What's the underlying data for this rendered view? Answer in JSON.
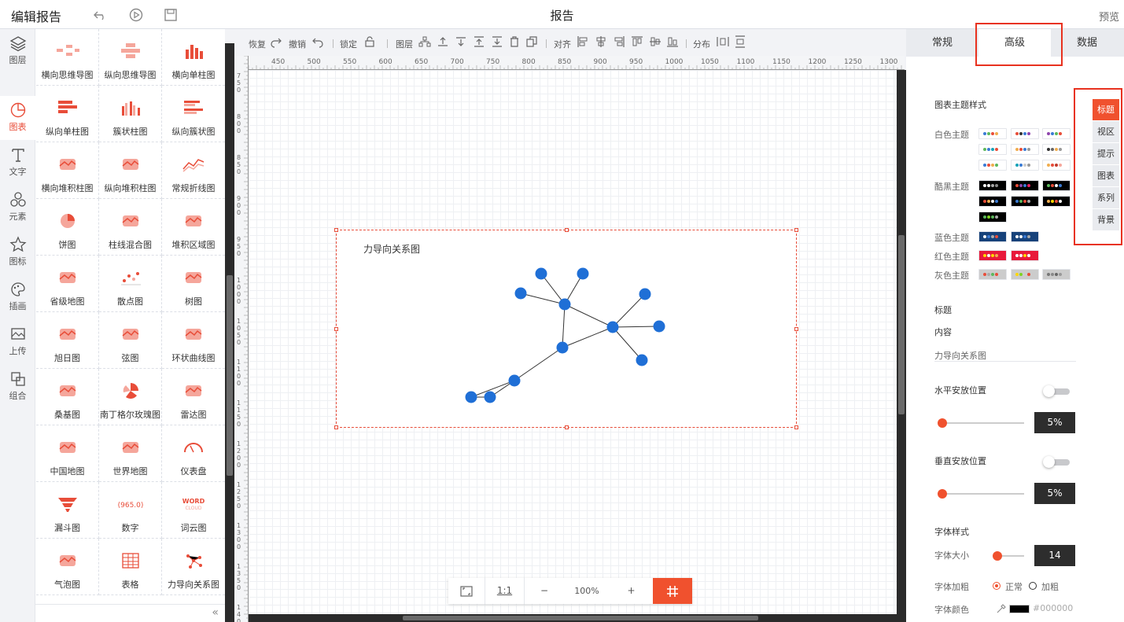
{
  "header": {
    "title": "编辑报告",
    "center": "报告",
    "preview": "预览"
  },
  "left_nav": [
    {
      "label": "图层",
      "icon": "layers-icon"
    },
    {
      "label": "图表",
      "icon": "chart-icon",
      "active": true
    },
    {
      "label": "文字",
      "icon": "text-icon"
    },
    {
      "label": "元素",
      "icon": "elements-icon"
    },
    {
      "label": "图标",
      "icon": "star-icon"
    },
    {
      "label": "插画",
      "icon": "palette-icon"
    },
    {
      "label": "上传",
      "icon": "upload-image-icon"
    },
    {
      "label": "组合",
      "icon": "group-icon"
    }
  ],
  "palette": [
    {
      "label": "横向思维导图"
    },
    {
      "label": "纵向思维导图"
    },
    {
      "label": "横向单柱图"
    },
    {
      "label": "纵向单柱图"
    },
    {
      "label": "簇状柱图"
    },
    {
      "label": "纵向簇状图"
    },
    {
      "label": "横向堆积柱图"
    },
    {
      "label": "纵向堆积柱图"
    },
    {
      "label": "常规折线图"
    },
    {
      "label": "饼图"
    },
    {
      "label": "柱线混合图"
    },
    {
      "label": "堆积区域图"
    },
    {
      "label": "省级地图"
    },
    {
      "label": "散点图"
    },
    {
      "label": "树图"
    },
    {
      "label": "旭日图"
    },
    {
      "label": "弦图"
    },
    {
      "label": "环状曲线图"
    },
    {
      "label": "桑基图"
    },
    {
      "label": "南丁格尔玫瑰图"
    },
    {
      "label": "雷达图"
    },
    {
      "label": "中国地图"
    },
    {
      "label": "世界地图"
    },
    {
      "label": "仪表盘"
    },
    {
      "label": "漏斗图"
    },
    {
      "label": "数字"
    },
    {
      "label": "词云图"
    },
    {
      "label": "气泡图"
    },
    {
      "label": "表格"
    },
    {
      "label": "力导向关系图"
    }
  ],
  "toolbar": {
    "redo": "恢复",
    "undo": "撤销",
    "lock": "锁定",
    "layer": "图层",
    "align": "对齐",
    "distribute": "分布"
  },
  "ruler": {
    "h_ticks": [
      "450",
      "500",
      "550",
      "600",
      "650",
      "700",
      "750",
      "800",
      "850",
      "900",
      "950",
      "1000",
      "1050",
      "1100",
      "1150",
      "1200",
      "1250",
      "1300"
    ],
    "v_ticks": [
      "750",
      "800",
      "850",
      "900",
      "950",
      "1000",
      "1050",
      "1100",
      "1150",
      "1200",
      "1250",
      "1300",
      "1350",
      "1400"
    ]
  },
  "chart": {
    "title": "力导向关系图",
    "node_color": "#1f6fd6"
  },
  "zoom": {
    "ratio": "1:1",
    "minus": "−",
    "value": "100%",
    "plus": "+"
  },
  "right_panel": {
    "tabs": [
      {
        "label": "常规"
      },
      {
        "label": "高级",
        "active": true
      },
      {
        "label": "数据"
      }
    ],
    "side_tabs": [
      {
        "label": "标题",
        "active": true
      },
      {
        "label": "视区"
      },
      {
        "label": "提示"
      },
      {
        "label": "图表"
      },
      {
        "label": "系列"
      },
      {
        "label": "背景"
      }
    ],
    "theme_heading": "图表主题样式",
    "theme_groups": [
      "白色主题",
      "酷黑主题",
      "蓝色主题",
      "红色主题",
      "灰色主题"
    ],
    "title_section": "标题",
    "content_label": "内容",
    "content_value": "力导向关系图",
    "h_pos_label": "水平安放位置",
    "h_pos_value": "5%",
    "v_pos_label": "垂直安放位置",
    "v_pos_value": "5%",
    "font_style_label": "字体样式",
    "font_size_label": "字体大小",
    "font_size_value": "14",
    "font_weight_label": "字体加粗",
    "weight_normal": "正常",
    "weight_bold": "加粗",
    "font_color_label": "字体颜色",
    "font_color_value": "#000000"
  },
  "accent": "#f0512e"
}
